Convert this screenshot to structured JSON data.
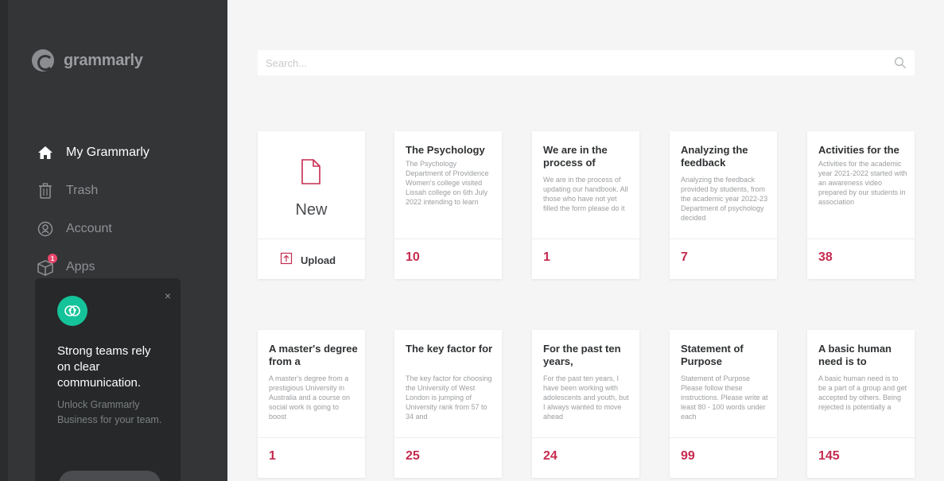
{
  "brand": {
    "name": "grammarly"
  },
  "nav": [
    {
      "label": "My Grammarly",
      "icon": "home-icon",
      "active": true
    },
    {
      "label": "Trash",
      "icon": "trash-icon"
    },
    {
      "label": "Account",
      "icon": "account-icon"
    },
    {
      "label": "Apps",
      "icon": "apps-icon",
      "badge": "1"
    }
  ],
  "promo": {
    "title": "Strong teams rely on clear communication.",
    "subtitle": "Unlock Grammarly Business for your team.",
    "close": "×"
  },
  "search": {
    "placeholder": "Search..."
  },
  "new_card": {
    "label": "New",
    "upload_label": "Upload"
  },
  "documents": [
    {
      "title": "The Psychology",
      "preview": "The Psychology Department of Providence Women's college visited Lissah college on 6th July 2022 intending to learn",
      "count": "10"
    },
    {
      "title": "We are in the process of",
      "preview": "We are in the process of updating our handbook. All those who have not yet filled the form please do it",
      "count": "1"
    },
    {
      "title": "Analyzing the feedback",
      "preview": "Analyzing the feedback provided by students, from the academic year 2022-23 Department of psychology decided",
      "count": "7"
    },
    {
      "title": "Activities for the",
      "preview": "Activities for the academic year 2021-2022 started with an awareness video prepared by our students in association",
      "count": "38"
    },
    {
      "title": "A master's degree from a",
      "preview": "A master's degree from a prestigious University in Australia and a course on social work is going to boost",
      "count": "1"
    },
    {
      "title": "The key factor for",
      "preview": "The key factor for choosing the University of West London is jumping of University rank from 57 to 34 and",
      "count": "25"
    },
    {
      "title": "For the past ten years,",
      "preview": "For the past ten years, I have been working with adolescents and youth, but I always wanted to move ahead",
      "count": "24"
    },
    {
      "title": "Statement of Purpose",
      "preview": "Statement of Purpose Please follow these instructions. Please write at least 80 - 100 words under each",
      "count": "99"
    },
    {
      "title": "A basic human need is to",
      "preview": "A basic human need is to be a part of a group and get accepted by others. Being rejected is potentially a",
      "count": "145"
    }
  ],
  "colors": {
    "sidebar": "#333537",
    "accent": "#c52b4f",
    "promo_icon": "#15c39a",
    "badge": "#e8466a"
  }
}
